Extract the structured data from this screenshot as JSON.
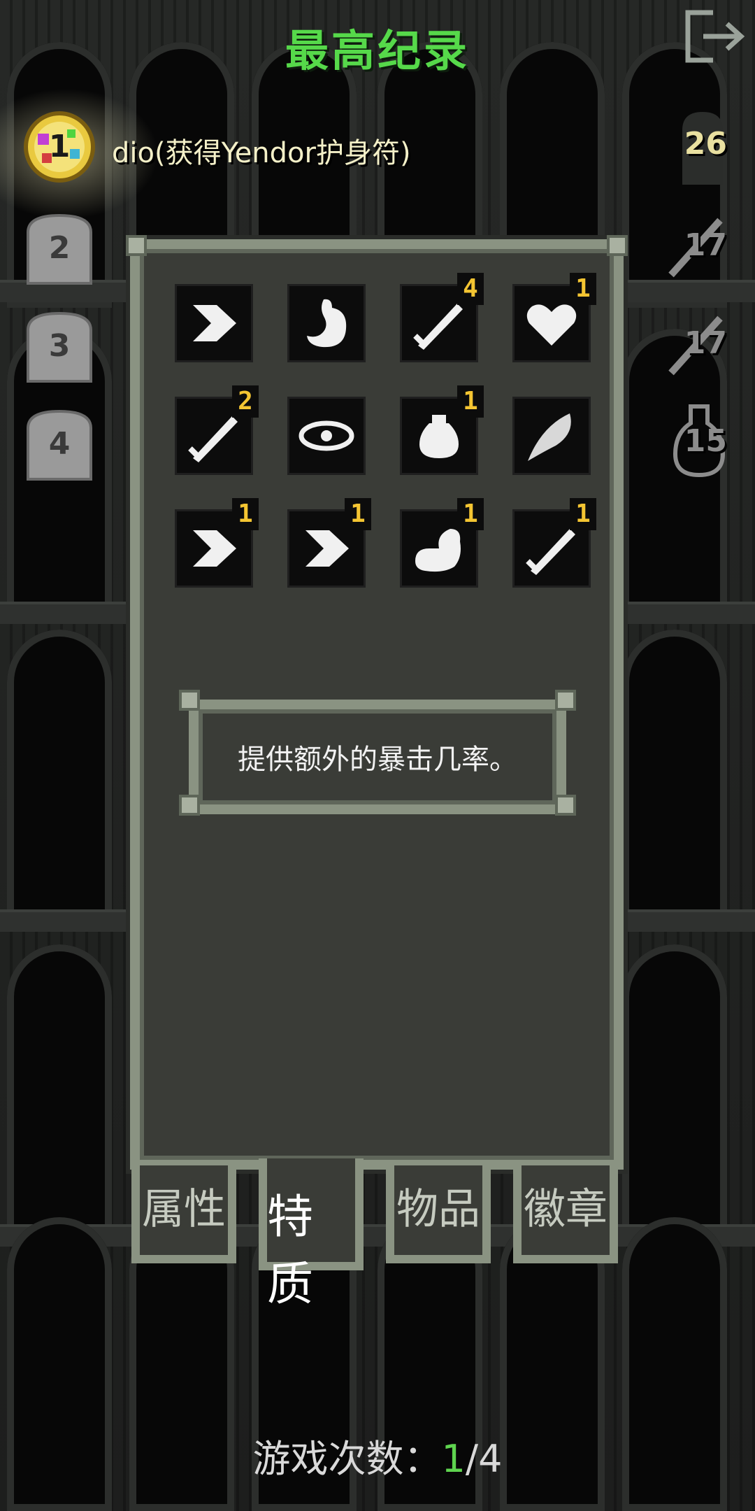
{
  "header": {
    "title": "最高纪录"
  },
  "records": [
    {
      "rank": "1",
      "text": "dio(获得Yendor护身符)",
      "right": "26"
    },
    {
      "rank": "2",
      "text": "",
      "right": "17"
    },
    {
      "rank": "3",
      "text": "",
      "right": "17"
    },
    {
      "rank": "4",
      "text": "",
      "right": "15"
    }
  ],
  "talents": [
    {
      "icon": "dash-icon",
      "count": ""
    },
    {
      "icon": "stomach-icon",
      "count": ""
    },
    {
      "icon": "sword-icon",
      "count": "4"
    },
    {
      "icon": "heart-icon",
      "count": "1"
    },
    {
      "icon": "sword-icon",
      "count": "2"
    },
    {
      "icon": "eye-icon",
      "count": ""
    },
    {
      "icon": "potion-icon",
      "count": "1"
    },
    {
      "icon": "feather-icon",
      "count": ""
    },
    {
      "icon": "dash-icon",
      "count": "1"
    },
    {
      "icon": "dash-icon",
      "count": "1"
    },
    {
      "icon": "muscle-icon",
      "count": "1"
    },
    {
      "icon": "sword-icon",
      "count": "1"
    }
  ],
  "description": "提供额外的暴击几率。",
  "tabs": [
    "属性",
    "特质",
    "物品",
    "徽章"
  ],
  "footer": {
    "label": "游戏次数：",
    "current": "1",
    "total": "/4"
  },
  "colors": {
    "title": "#56d94a",
    "count": "#f4c532",
    "panel_border": "#8a9382"
  }
}
